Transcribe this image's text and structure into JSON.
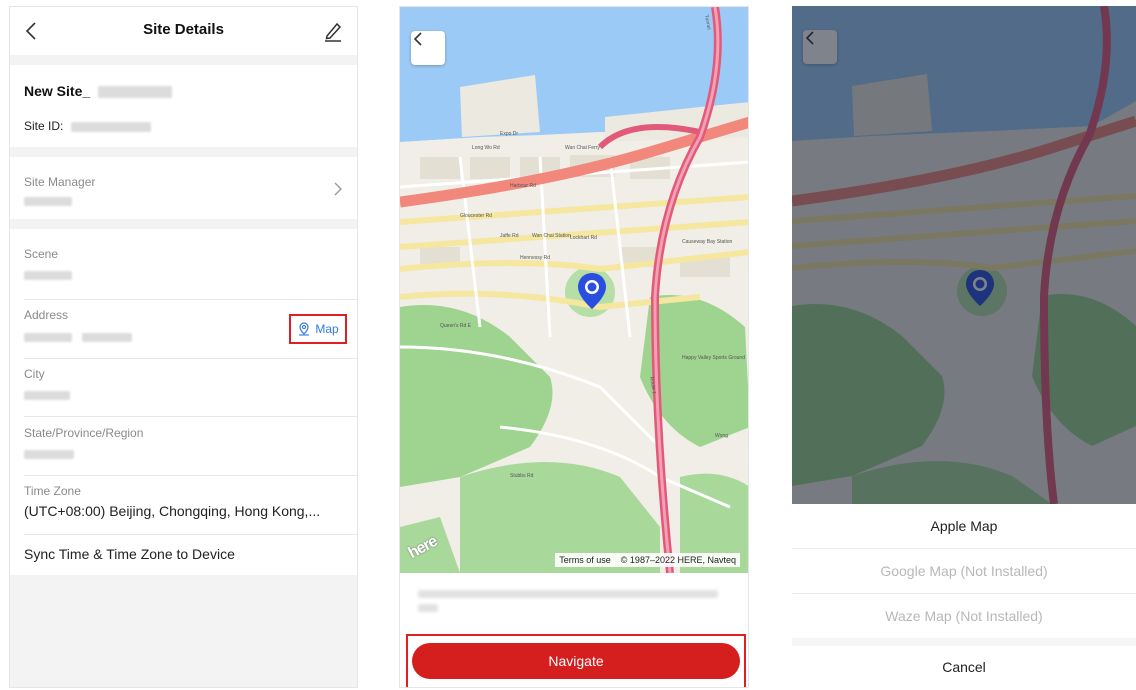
{
  "site_details": {
    "title": "Site Details",
    "site_name": "New Site_",
    "site_id_label": "Site ID:",
    "site_manager_label": "Site Manager",
    "scene_label": "Scene",
    "address_label": "Address",
    "map_link": "Map",
    "city_label": "City",
    "state_label": "State/Province/Region",
    "timezone_label": "Time Zone",
    "timezone_value": "(UTC+08:00) Beijing, Chongqing, Hong Kong,...",
    "sync_label": "Sync Time & Time Zone to Device",
    "icons": [
      "chevron-left-icon",
      "pencil-edit-icon",
      "chevron-right-icon",
      "map-pin-icon"
    ],
    "accent_color": "#2c7be5",
    "highlight_color": "#e02020"
  },
  "map_view": {
    "labels": {
      "wan_chai_ferry": "Wan Chai Ferry",
      "long_wo_rd": "Long Wo Rd",
      "expo_dr": "Expo Dr",
      "harbour_rd": "Harbour Rd",
      "gloucester_rd": "Gloucester Rd",
      "jaffe_rd": "Jaffe Rd",
      "lockhart_rd": "Lockhart Rd",
      "hennessy_rd": "Hennessy Rd",
      "wan_chai_station": "Wan Chai Station",
      "causeway_bay_station": "Causeway Bay Station",
      "queens_rd_e": "Queen's Rd E",
      "stubbs_rd": "Stubbs Rd",
      "happy_valley": "Happy Valley Sports Ground",
      "route_1": "Route 1",
      "tunnel": "Tunnel",
      "wong_nai": "Wong"
    },
    "terms": "Terms of use",
    "copyright": "© 1987–2022 HERE, Navteq",
    "logo": "here",
    "navigate_button": "Navigate",
    "button_color": "#d51e1e"
  },
  "app_picker": {
    "options": [
      {
        "label": "Apple Map",
        "enabled": true
      },
      {
        "label": "Google Map (Not Installed)",
        "enabled": false
      },
      {
        "label": "Waze Map (Not Installed)",
        "enabled": false
      }
    ],
    "cancel": "Cancel"
  }
}
